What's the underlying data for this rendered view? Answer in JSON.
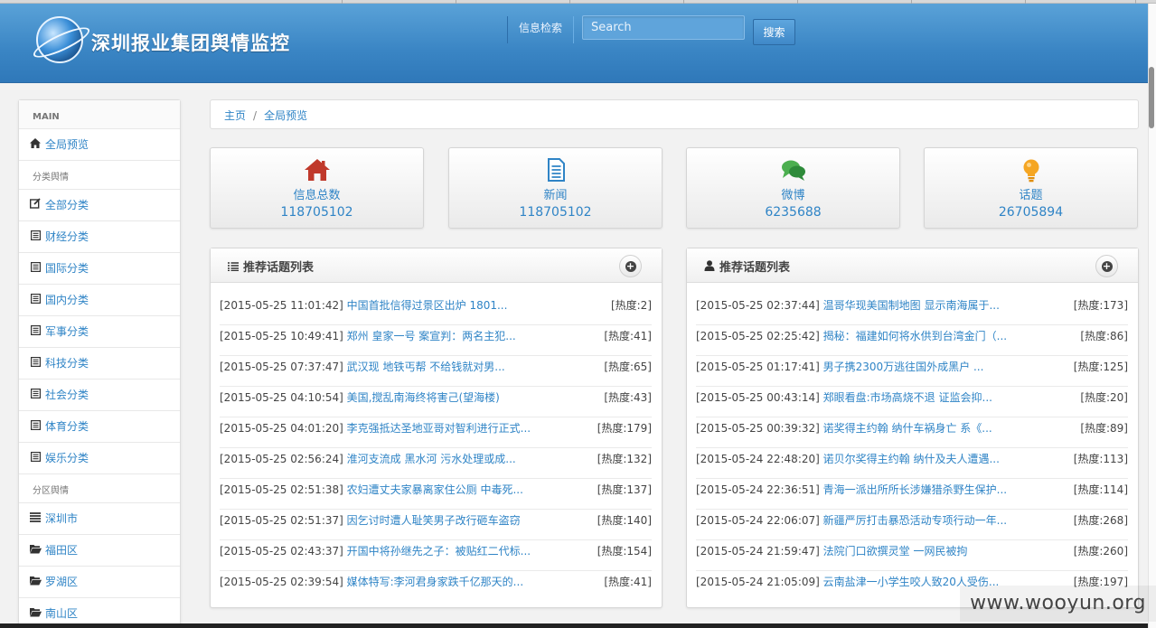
{
  "header": {
    "title": "深圳报业集团舆情监控",
    "search_label": "信息检索",
    "search_placeholder": "Search",
    "search_button": "搜索"
  },
  "sidebar": {
    "main_header": "MAIN",
    "overview": "全局预览",
    "group_category": "分类舆情",
    "categories": [
      "全部分类",
      "财经分类",
      "国际分类",
      "国内分类",
      "军事分类",
      "科技分类",
      "社会分类",
      "体育分类",
      "娱乐分类"
    ],
    "group_region": "分区舆情",
    "regions": [
      "深圳市",
      "福田区",
      "罗湖区",
      "南山区"
    ]
  },
  "breadcrumb": {
    "home": "主页",
    "separator": "/",
    "current": "全局预览"
  },
  "stats": [
    {
      "icon": "home-icon",
      "label": "信息总数",
      "value": "118705102",
      "color": "#c0392b"
    },
    {
      "icon": "document-icon",
      "label": "新闻",
      "value": "118705102",
      "color": "#2f84c6"
    },
    {
      "icon": "chat-bubble-icon",
      "label": "微博",
      "value": "6235688",
      "color": "#3aa34a"
    },
    {
      "icon": "lightbulb-icon",
      "label": "话题",
      "value": "26705894",
      "color": "#f39c12"
    }
  ],
  "panels": [
    {
      "title": "推荐话题列表",
      "icon": "list-icon",
      "rows": [
        {
          "time": "[2015-05-25 11:01:42]",
          "title": "中国首批信得过景区出炉 1801...",
          "heat": "[热度:2]"
        },
        {
          "time": "[2015-05-25 10:49:41]",
          "title": "郑州 皇家一号 案宣判：两名主犯...",
          "heat": "[热度:41]"
        },
        {
          "time": "[2015-05-25 07:37:47]",
          "title": "武汉现 地铁丐帮 不给钱就对男...",
          "heat": "[热度:65]"
        },
        {
          "time": "[2015-05-25 04:10:54]",
          "title": "美国,搅乱南海终将害己(望海楼)",
          "heat": "[热度:43]"
        },
        {
          "time": "[2015-05-25 04:01:20]",
          "title": "李克强抵达圣地亚哥对智利进行正式...",
          "heat": "[热度:179]"
        },
        {
          "time": "[2015-05-25 02:56:24]",
          "title": "淮河支流成 黑水河 污水处理或成...",
          "heat": "[热度:132]"
        },
        {
          "time": "[2015-05-25 02:51:38]",
          "title": "农妇遭丈夫家暴离家住公厕 中毒死...",
          "heat": "[热度:137]"
        },
        {
          "time": "[2015-05-25 02:51:37]",
          "title": "因乞讨时遭人耻笑男子改行砸车盗窃",
          "heat": "[热度:140]"
        },
        {
          "time": "[2015-05-25 02:43:37]",
          "title": "开国中将孙继先之子：被贴红二代标...",
          "heat": "[热度:154]"
        },
        {
          "time": "[2015-05-25 02:39:54]",
          "title": "媒体特写:李河君身家跌千亿那天的...",
          "heat": "[热度:41]"
        }
      ]
    },
    {
      "title": "推荐话题列表",
      "icon": "user-icon",
      "rows": [
        {
          "time": "[2015-05-25 02:37:44]",
          "title": "温哥华现美国制地图 显示南海属于...",
          "heat": "[热度:173]"
        },
        {
          "time": "[2015-05-25 02:25:42]",
          "title": "揭秘：福建如何将水供到台湾金门（...",
          "heat": "[热度:86]"
        },
        {
          "time": "[2015-05-25 01:17:41]",
          "title": "男子携2300万逃往国外成黑户 ...",
          "heat": "[热度:125]"
        },
        {
          "time": "[2015-05-25 00:43:14]",
          "title": "郑眼看盘:市场高烧不退 证监会抑...",
          "heat": "[热度:20]"
        },
        {
          "time": "[2015-05-25 00:39:32]",
          "title": "诺奖得主约翰 纳什车祸身亡 系《...",
          "heat": "[热度:89]"
        },
        {
          "time": "[2015-05-24 22:48:20]",
          "title": "诺贝尔奖得主约翰 纳什及夫人遭遇...",
          "heat": "[热度:113]"
        },
        {
          "time": "[2015-05-24 22:36:51]",
          "title": "青海一派出所所长涉嫌猎杀野生保护...",
          "heat": "[热度:114]"
        },
        {
          "time": "[2015-05-24 22:06:07]",
          "title": "新疆严厉打击暴恐活动专项行动一年...",
          "heat": "[热度:268]"
        },
        {
          "time": "[2015-05-24 21:59:47]",
          "title": "法院门口欲撰灵堂 一网民被拘",
          "heat": "[热度:260]"
        },
        {
          "time": "[2015-05-24 21:05:09]",
          "title": "云南盐津一小学生咬人致20人受伤...",
          "heat": "[热度:197]"
        }
      ]
    }
  ],
  "watermark": "www.wooyun.org"
}
